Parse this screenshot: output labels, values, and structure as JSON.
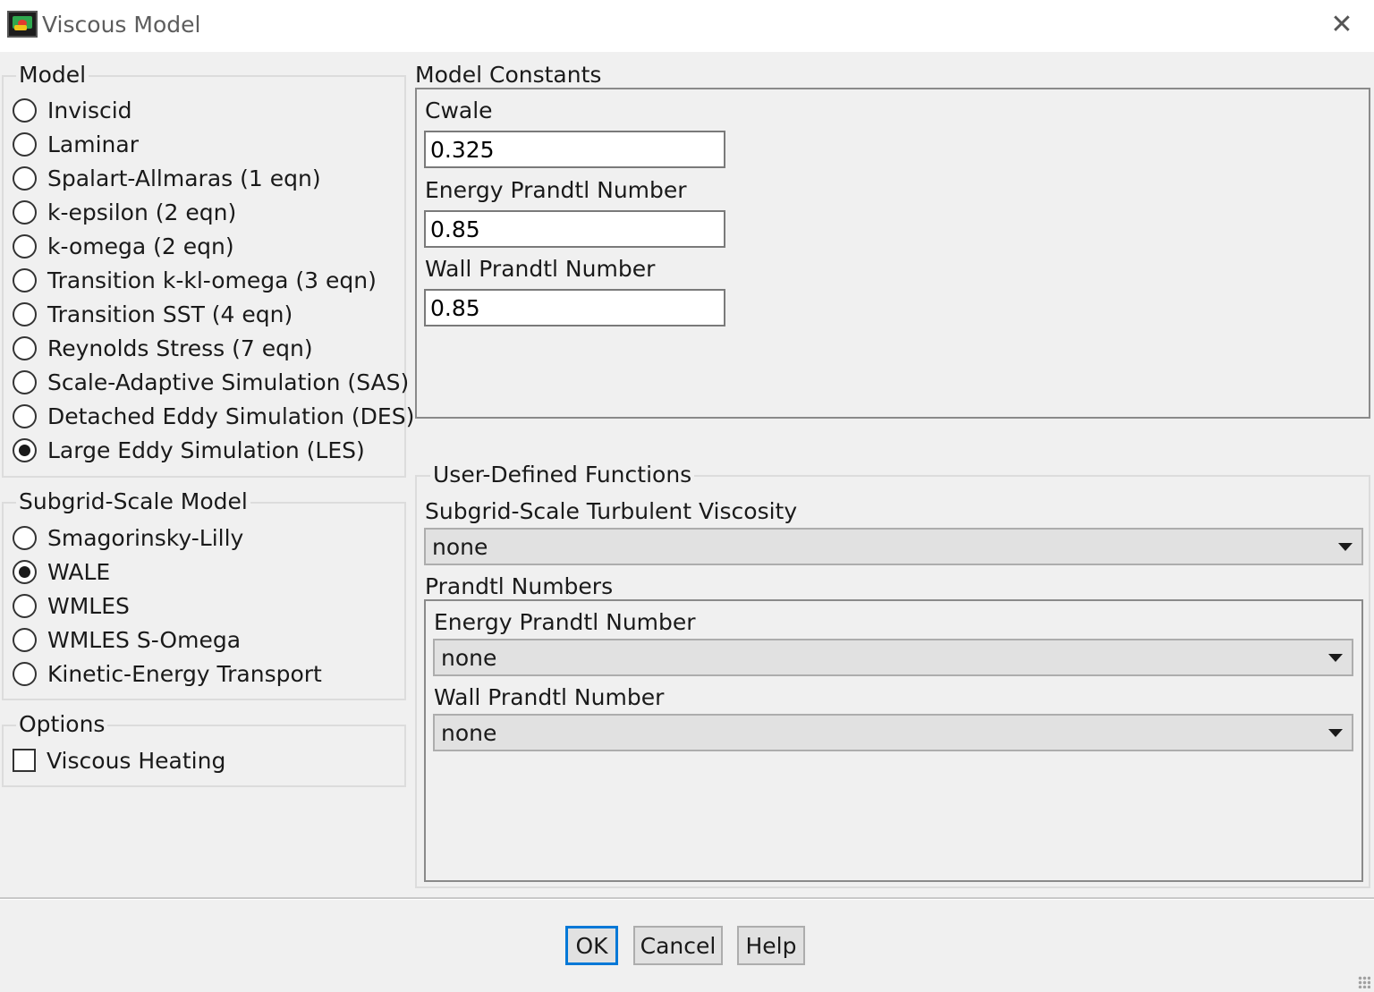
{
  "window": {
    "title": "Viscous Model",
    "close_label": "✕"
  },
  "model": {
    "legend": "Model",
    "options": [
      {
        "label": "Inviscid",
        "checked": false
      },
      {
        "label": "Laminar",
        "checked": false
      },
      {
        "label": "Spalart-Allmaras (1 eqn)",
        "checked": false
      },
      {
        "label": "k-epsilon (2 eqn)",
        "checked": false
      },
      {
        "label": "k-omega (2 eqn)",
        "checked": false
      },
      {
        "label": "Transition k-kl-omega (3 eqn)",
        "checked": false
      },
      {
        "label": "Transition SST (4 eqn)",
        "checked": false
      },
      {
        "label": "Reynolds Stress (7 eqn)",
        "checked": false
      },
      {
        "label": "Scale-Adaptive Simulation (SAS)",
        "checked": false
      },
      {
        "label": "Detached Eddy Simulation (DES)",
        "checked": false
      },
      {
        "label": "Large Eddy Simulation (LES)",
        "checked": true
      }
    ]
  },
  "subgrid": {
    "legend": "Subgrid-Scale Model",
    "options": [
      {
        "label": "Smagorinsky-Lilly",
        "checked": false
      },
      {
        "label": "WALE",
        "checked": true
      },
      {
        "label": "WMLES",
        "checked": false
      },
      {
        "label": "WMLES S-Omega",
        "checked": false
      },
      {
        "label": "Kinetic-Energy Transport",
        "checked": false
      }
    ]
  },
  "options": {
    "legend": "Options",
    "viscous_heating_label": "Viscous Heating",
    "viscous_heating_checked": false
  },
  "constants": {
    "legend": "Model Constants",
    "cwale_label": "Cwale",
    "cwale_value": "0.325",
    "energy_prandtl_label": "Energy Prandtl Number",
    "energy_prandtl_value": "0.85",
    "wall_prandtl_label": "Wall Prandtl Number",
    "wall_prandtl_value": "0.85"
  },
  "udf": {
    "legend": "User-Defined Functions",
    "sgs_viscosity_label": "Subgrid-Scale Turbulent Viscosity",
    "sgs_viscosity_value": "none",
    "prandtl_numbers_legend": "Prandtl Numbers",
    "energy_prandtl_label": "Energy Prandtl Number",
    "energy_prandtl_value": "none",
    "wall_prandtl_label": "Wall Prandtl Number",
    "wall_prandtl_value": "none"
  },
  "buttons": {
    "ok": "OK",
    "cancel": "Cancel",
    "help": "Help"
  },
  "colors": {
    "background": "#f0f0f0",
    "titlebar": "#ffffff",
    "default_button_border": "#0078d7"
  }
}
